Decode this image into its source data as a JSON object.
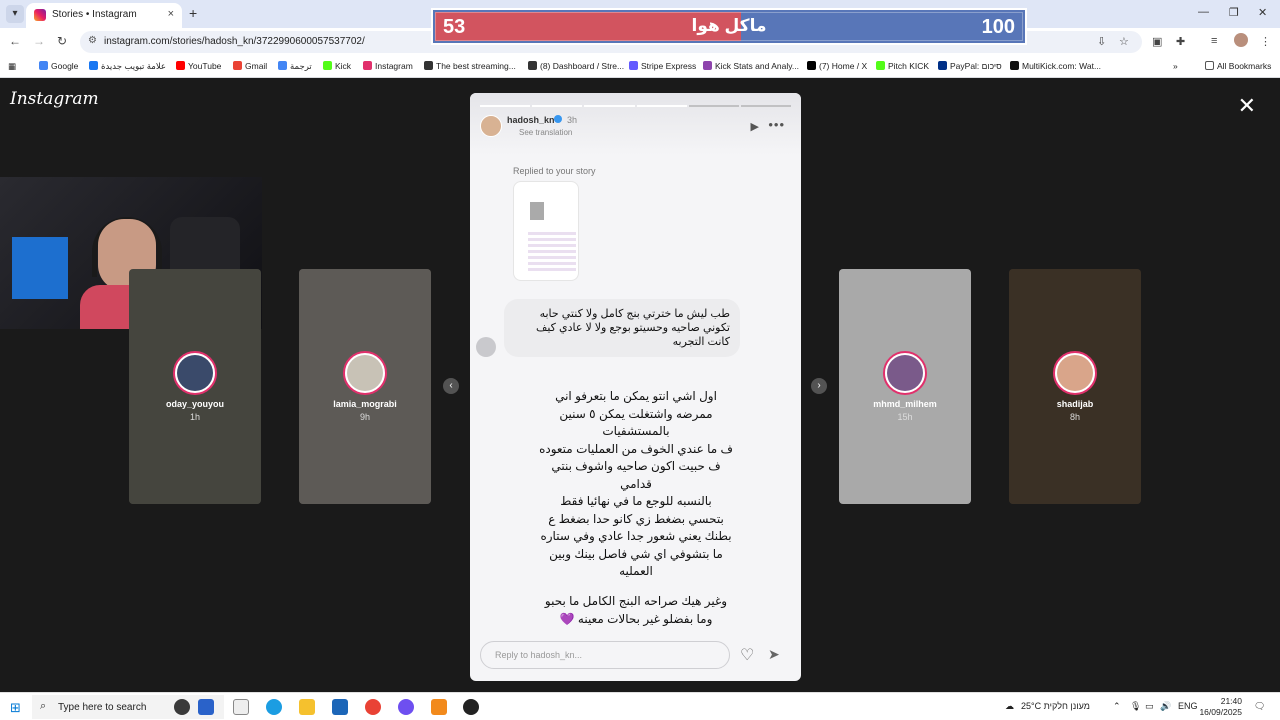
{
  "browser": {
    "tab_list_icon": "chevron-down-icon",
    "tab_title": "Stories • Instagram",
    "tab_close": "×",
    "new_tab": "+",
    "url": "instagram.com/stories/hadosh_kn/3722990600057537702/",
    "window_controls": {
      "minimize": "—",
      "maximize": "❐",
      "close": "✕"
    },
    "bookmarks": [
      {
        "label": "Google",
        "color": "#4285f4"
      },
      {
        "label": "علامة تبويب جديدة",
        "color": "#1877f2"
      },
      {
        "label": "YouTube",
        "color": "#ff0000"
      },
      {
        "label": "Gmail",
        "color": "#ea4335"
      },
      {
        "label": "ترجمة",
        "color": "#4285f4"
      },
      {
        "label": "Kick",
        "color": "#53fc18"
      },
      {
        "label": "Instagram",
        "color": "#e1306c"
      },
      {
        "label": "The best streaming...",
        "color": "#333333"
      },
      {
        "label": "(8) Dashboard / Stre...",
        "color": "#333333"
      },
      {
        "label": "Stripe Express",
        "color": "#635bff"
      },
      {
        "label": "Kick Stats and Analy...",
        "color": "#8e44ad"
      },
      {
        "label": "(7) Home / X",
        "color": "#000000"
      },
      {
        "label": "Pitch KICK",
        "color": "#53fc18"
      },
      {
        "label": "PayPal: סיכום",
        "color": "#003087"
      },
      {
        "label": "MultiKick.com: Wat...",
        "color": "#111111"
      }
    ],
    "more_bookmarks": "»",
    "all_bookmarks": "All Bookmarks"
  },
  "score_overlay": {
    "left_value": "53",
    "right_value": "100",
    "center_text": "ماكل هوا",
    "red_fill_fraction": 0.52,
    "left_color": "#d2545f",
    "right_color": "#5876b8"
  },
  "instagram": {
    "logo": "Instagram",
    "close": "✕",
    "side_stories": [
      {
        "name": "oday_youyou",
        "time": "1h",
        "bg": "#6b6b60",
        "avatar": "#3a4a6a"
      },
      {
        "name": "lamia_mograbi",
        "time": "9h",
        "bg": "#8f8a84",
        "avatar": "#c8c2b6"
      },
      {
        "name": "mhmd_milhem",
        "time": "15h",
        "bg": "#bdbdbd",
        "avatar": "#7a5a8a"
      },
      {
        "name": "shadijab",
        "time": "8h",
        "bg": "#5a4a3a",
        "avatar": "#d9a58a"
      }
    ],
    "story": {
      "username": "hadosh_kn",
      "time": "3h",
      "see_translation": "See translation",
      "progress_segments": 6,
      "progress_done": 4,
      "replied_label": "Replied to your story",
      "bubble_text": "طب ليش ما خترتي بنج كامل ولا كنتي حابه تكوني صاحيه وحسيتو بوجع ولا لا عادي كيف كانت التجربه",
      "message_1": "اول اشي انتو يمكن ما بتعرفو اني\nممرضه واشتغلت يمكن ٥ سنين\nبالمستشفيات\nف ما عندي الخوف من العمليات متعوده\nف حبيت اكون صاحيه واشوف بنتي\nقدامي\nبالنسبه للوجع ما في نهائيا فقط\nبتحسي بضغط زي كانو حدا بضغط ع\nبطنك يعني شعور جدا عادي وفي ستاره\nما بتشوفي اي شي فاصل بينك وبين\nالعمليه",
      "message_2": "وغير هيك صراحه البنج الكامل ما بحبو\nوما بفضلو غير بحالات معينه 💜",
      "reply_placeholder": "Reply to hadosh_kn..."
    }
  },
  "taskbar": {
    "search_placeholder": "Type here to search",
    "weather": "25°C  מעונן חלקית",
    "language": "ENG",
    "time": "21:40",
    "date": "16/09/2025"
  }
}
